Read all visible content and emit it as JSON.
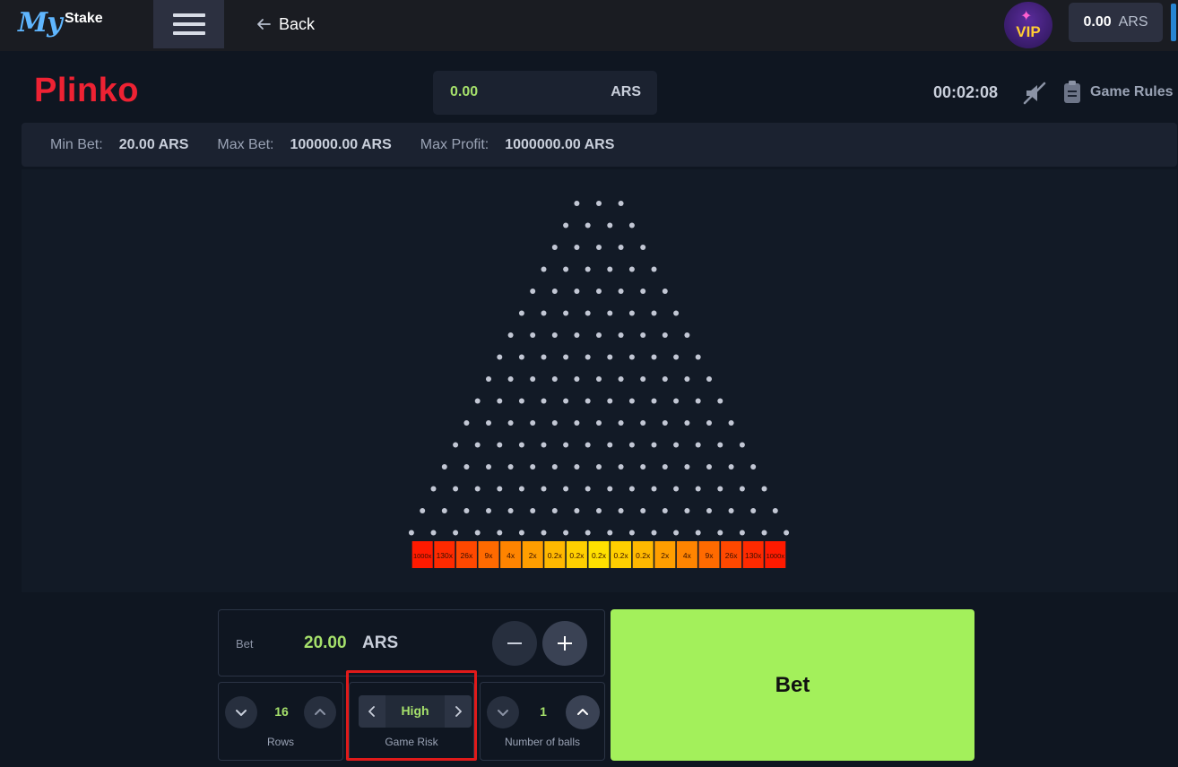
{
  "header": {
    "logo_my": "My",
    "logo_stake": "Stake",
    "back_label": "Back",
    "vip_label": "VIP",
    "wallet_amount": "0.00",
    "wallet_currency": "ARS"
  },
  "game": {
    "title": "Plinko",
    "balance_amount": "0.00",
    "balance_currency": "ARS",
    "timer": "00:02:08",
    "rules_label": "Game Rules"
  },
  "limits": {
    "min_label": "Min Bet:",
    "min_value": "20.00 ARS",
    "max_label": "Max Bet:",
    "max_value": "100000.00 ARS",
    "profit_label": "Max Profit:",
    "profit_value": "1000000.00 ARS"
  },
  "board": {
    "rows": 16,
    "multipliers": [
      "1000x",
      "130x",
      "26x",
      "9x",
      "4x",
      "2x",
      "0.2x",
      "0.2x",
      "0.2x",
      "0.2x",
      "0.2x",
      "2x",
      "4x",
      "9x",
      "26x",
      "130x",
      "1000x"
    ],
    "bucket_colors": [
      "#ff1a00",
      "#ff2a00",
      "#ff4800",
      "#ff6a00",
      "#ff8400",
      "#ff9e00",
      "#ffb800",
      "#ffcf00",
      "#ffe000",
      "#ffcf00",
      "#ffb800",
      "#ff9e00",
      "#ff8400",
      "#ff6a00",
      "#ff4800",
      "#ff2a00",
      "#ff1a00"
    ],
    "peg_color": "#c2c7d4"
  },
  "controls": {
    "bet_label": "Bet",
    "bet_amount": "20.00",
    "bet_currency": "ARS",
    "rows_value": "16",
    "rows_label": "Rows",
    "risk_value": "High",
    "risk_label": "Game Risk",
    "balls_value": "1",
    "balls_label": "Number of balls",
    "bet_button": "Bet"
  },
  "colors": {
    "accent_green": "#a3f05b",
    "title_red": "#ee2233",
    "highlight_red": "#e01a1a"
  }
}
